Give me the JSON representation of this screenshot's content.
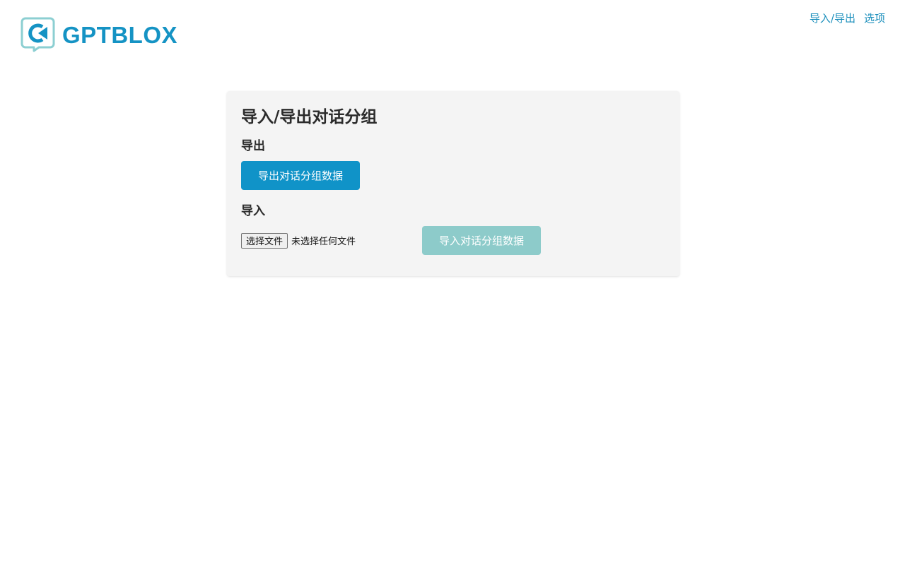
{
  "brand": {
    "name": "GPTBLOX",
    "color": "#1593c4"
  },
  "nav": {
    "import_export": "导入/导出",
    "options": "选项"
  },
  "card": {
    "title": "导入/导出对话分组",
    "export": {
      "heading": "导出",
      "button_label": "导出对话分组数据"
    },
    "import": {
      "heading": "导入",
      "choose_file_label": "选择文件",
      "file_status": "未选择任何文件",
      "button_label": "导入对话分组数据",
      "button_enabled": false
    }
  },
  "colors": {
    "primary_button": "#1093c8",
    "disabled_button": "#8dcbca",
    "card_background": "#f4f4f4",
    "logo_frame": "#8ccfd2"
  },
  "icons": {
    "logo": "chat-bubble-play-icon"
  }
}
